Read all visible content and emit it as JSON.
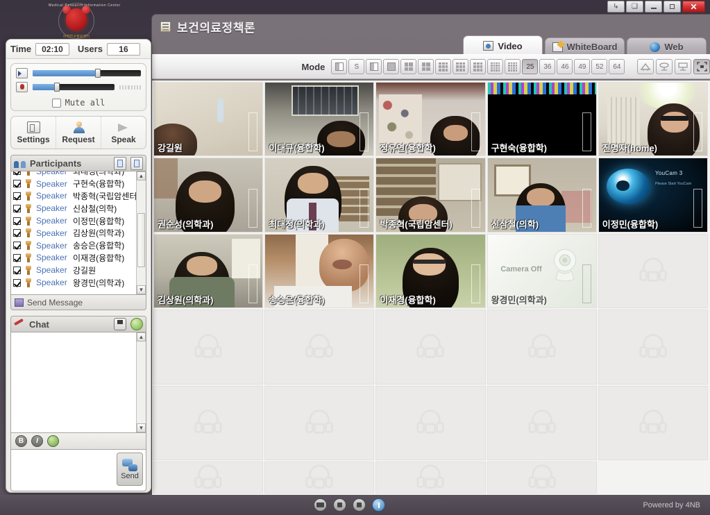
{
  "desktop": {
    "logo_top_text": "Medical Research Information Center",
    "logo_bottom_text": "의학연구정보센터"
  },
  "window_controls": [
    {
      "name": "restore-down-button",
      "glyph": "↳"
    },
    {
      "name": "duplicate-button",
      "glyph": "❑"
    },
    {
      "name": "minimize-button",
      "glyph": ""
    },
    {
      "name": "maximize-button",
      "glyph": ""
    },
    {
      "name": "close-button",
      "glyph": "✕"
    }
  ],
  "app": {
    "title": "보건의료정책론",
    "tabs": [
      {
        "label": "Video",
        "icon": "video-icon",
        "active": true
      },
      {
        "label": "WhiteBoard",
        "icon": "whiteboard-icon",
        "active": false
      },
      {
        "label": "Web",
        "icon": "globe-icon",
        "active": false
      }
    ]
  },
  "toolbar": {
    "time_label": "Time",
    "time_value": "02:10",
    "users_label": "Users",
    "users_value": "16",
    "mode_label": "Mode",
    "mode_buttons": [
      {
        "id": "layout-single",
        "glyph": "",
        "selected": false
      },
      {
        "id": "layout-s",
        "glyph": "S",
        "selected": false
      },
      {
        "id": "layout-two-col",
        "glyph": "",
        "selected": false
      },
      {
        "id": "layout-pip",
        "glyph": "",
        "selected": false
      },
      {
        "id": "layout-4",
        "glyph": "",
        "selected": false
      },
      {
        "id": "layout-1plus",
        "glyph": "",
        "selected": false
      },
      {
        "id": "layout-9",
        "glyph": "",
        "selected": false
      },
      {
        "id": "layout-big-plus",
        "glyph": "",
        "selected": false
      },
      {
        "id": "layout-9b",
        "glyph": "",
        "selected": false
      },
      {
        "id": "layout-16",
        "glyph": "",
        "selected": false
      },
      {
        "id": "layout-16b",
        "glyph": "",
        "selected": false
      },
      {
        "id": "layout-25",
        "glyph": "25",
        "selected": true
      },
      {
        "id": "layout-36",
        "glyph": "36",
        "selected": false
      },
      {
        "id": "layout-46",
        "glyph": "46",
        "selected": false
      },
      {
        "id": "layout-49",
        "glyph": "49",
        "selected": false
      },
      {
        "id": "layout-52",
        "glyph": "52",
        "selected": false
      },
      {
        "id": "layout-64",
        "glyph": "64",
        "selected": false
      }
    ],
    "extra_buttons": [
      {
        "id": "classroom-view-button",
        "icon": "classroom-icon",
        "selected": false
      },
      {
        "id": "seminar-view-button",
        "icon": "seminar-icon",
        "selected": false
      },
      {
        "id": "lecture-view-button",
        "icon": "lecture-icon",
        "selected": false
      },
      {
        "id": "fullscreen-button",
        "icon": "fullscreen-icon",
        "selected": true
      }
    ]
  },
  "left_panel": {
    "volume": {
      "speaker_icon": "speaker-icon",
      "speaker_level": 62,
      "mic_icon": "microphone-muted-icon",
      "mic_level": 30,
      "mute_all_label": "Mute all",
      "mute_all_checked": false
    },
    "actions": [
      {
        "label": "Settings",
        "icon": "settings-icon"
      },
      {
        "label": "Request",
        "icon": "request-icon"
      },
      {
        "label": "Speak",
        "icon": "megaphone-icon"
      }
    ],
    "participants": {
      "title": "Participants",
      "header_buttons": [
        "copy-list-icon",
        "paste-list-icon"
      ],
      "rows": [
        {
          "role": "Speaker",
          "name": "최대정(의학과)",
          "checked": true
        },
        {
          "role": "Speaker",
          "name": "구현숙(융합학)",
          "checked": true
        },
        {
          "role": "Speaker",
          "name": "박종혁(국립암센터",
          "checked": true
        },
        {
          "role": "Speaker",
          "name": "신삼철(의학)",
          "checked": true
        },
        {
          "role": "Speaker",
          "name": "이정민(융합학)",
          "checked": true
        },
        {
          "role": "Speaker",
          "name": "김상원(의학과)",
          "checked": true
        },
        {
          "role": "Speaker",
          "name": "송승은(융합학)",
          "checked": true
        },
        {
          "role": "Speaker",
          "name": "이재경(융합학)",
          "checked": true
        },
        {
          "role": "Speaker",
          "name": "강길원",
          "checked": true
        },
        {
          "role": "Speaker",
          "name": "왕경민(의학과)",
          "checked": true
        }
      ],
      "send_message_label": "Send Message"
    },
    "chat": {
      "title": "Chat",
      "save_icon": "save-icon",
      "refresh_icon": "refresh-icon",
      "log": "",
      "format_buttons": [
        "B",
        "I"
      ],
      "color_button": "color-picker-icon",
      "input_value": "",
      "send_label": "Send"
    }
  },
  "video_grid": {
    "columns": 5,
    "rows": 5,
    "cells": [
      {
        "name": "강길원",
        "state": "video",
        "theme": "room-beige",
        "label_color": "light"
      },
      {
        "name": "이대규(융합학)",
        "state": "video",
        "theme": "room-window",
        "label_color": "light"
      },
      {
        "name": "정유연(융합학)",
        "state": "video",
        "theme": "room-photowall",
        "label_color": "light"
      },
      {
        "name": "구현숙(융합학)",
        "state": "video",
        "theme": "dark-static",
        "label_color": "light"
      },
      {
        "name": "진명자(home)",
        "state": "video",
        "theme": "room-bright",
        "label_color": "light"
      },
      {
        "name": "권순성(의학과)",
        "state": "video",
        "theme": "room-grey",
        "label_color": "light"
      },
      {
        "name": "최대정(의학과)",
        "state": "video",
        "theme": "room-shelf",
        "label_color": "light"
      },
      {
        "name": "박종혁(국립암센터)",
        "state": "video",
        "theme": "room-office",
        "label_color": "light"
      },
      {
        "name": "신삼철(의학)",
        "state": "video",
        "theme": "room-desk",
        "label_color": "light"
      },
      {
        "name": "이정민(융합학)",
        "state": "youcam",
        "theme": "youcam",
        "label_color": "light",
        "overlay_title": "YouCam 3",
        "overlay_sub": "Please Start YouCam"
      },
      {
        "name": "김상원(의학과)",
        "state": "video",
        "theme": "room-olive",
        "label_color": "light"
      },
      {
        "name": "송승은(융합학)",
        "state": "video",
        "theme": "room-wood",
        "label_color": "light"
      },
      {
        "name": "이재경(융합학)",
        "state": "video",
        "theme": "room-green",
        "label_color": "light"
      },
      {
        "name": "왕경민(의학과)",
        "state": "camera-off",
        "theme": "camera-off",
        "label_color": "dark",
        "overlay_title": "Camera Off"
      },
      {
        "name": "",
        "state": "empty"
      },
      {
        "name": "",
        "state": "empty"
      },
      {
        "name": "",
        "state": "empty"
      },
      {
        "name": "",
        "state": "empty"
      },
      {
        "name": "",
        "state": "empty"
      },
      {
        "name": "",
        "state": "empty"
      },
      {
        "name": "",
        "state": "empty"
      },
      {
        "name": "",
        "state": "empty"
      },
      {
        "name": "",
        "state": "empty"
      },
      {
        "name": "",
        "state": "empty"
      },
      {
        "name": "",
        "state": "empty"
      }
    ]
  },
  "bottom_bar": {
    "icons": [
      {
        "id": "record-video-button",
        "icon": "camcorder-icon"
      },
      {
        "id": "stop-button",
        "icon": "stop-icon"
      },
      {
        "id": "archive-button",
        "icon": "archive-icon"
      },
      {
        "id": "power-button",
        "icon": "power-icon"
      }
    ],
    "powered_by": "Powered by 4NB"
  }
}
